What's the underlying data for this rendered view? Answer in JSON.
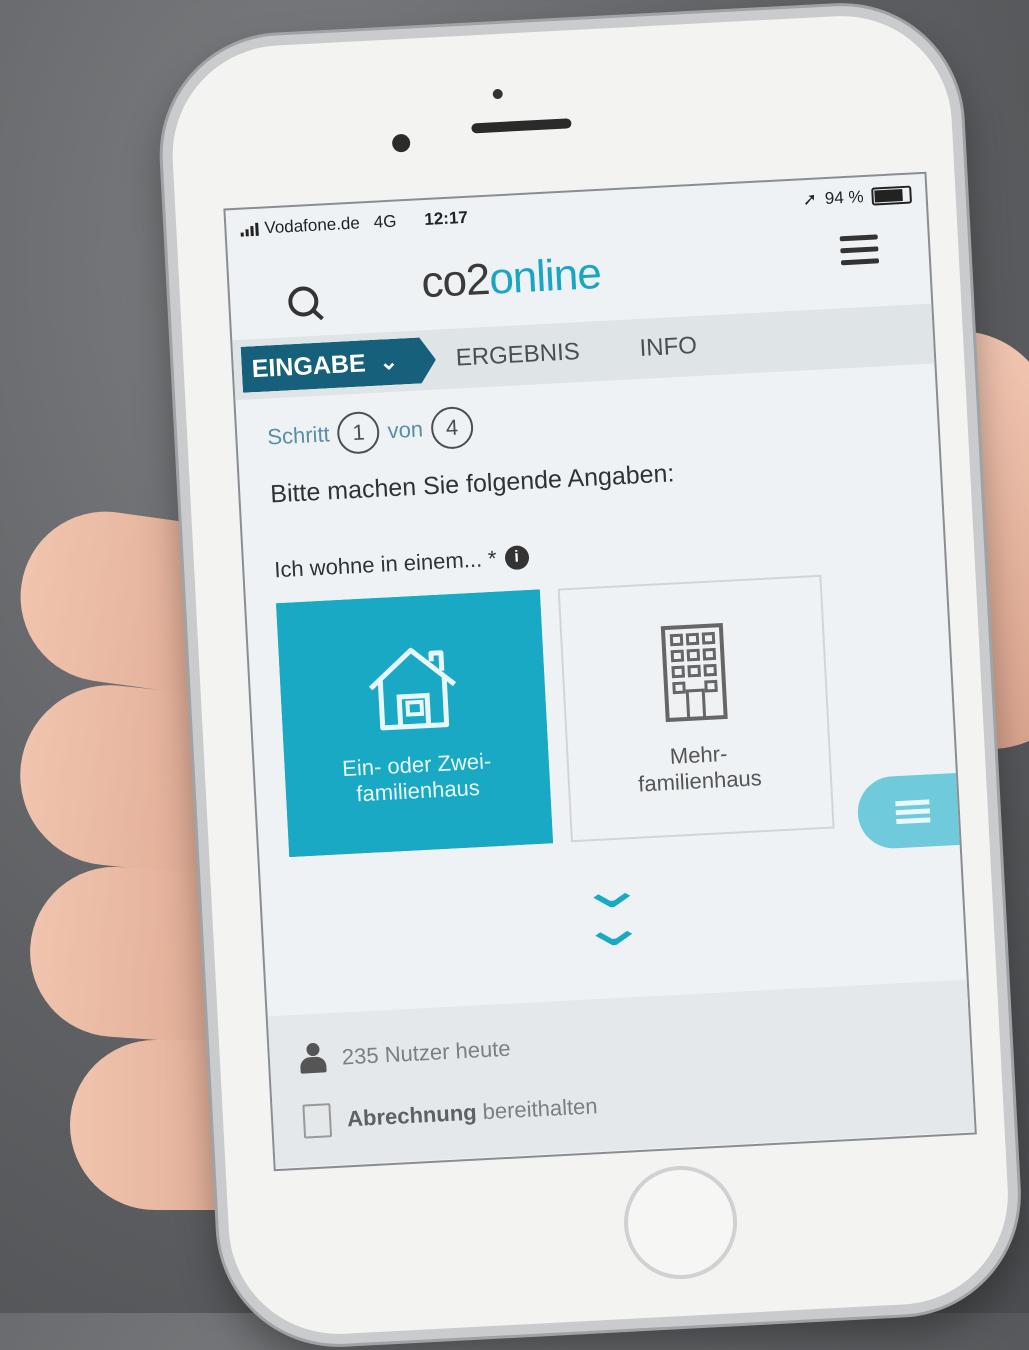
{
  "status_bar": {
    "carrier": "Vodafone.de",
    "network": "4G",
    "time": "12:17",
    "battery": "94 %"
  },
  "header": {
    "logo_prefix": "co2",
    "logo_suffix": "online"
  },
  "tabs": {
    "active": "EINGABE",
    "items": [
      "ERGEBNIS",
      "INFO"
    ]
  },
  "progress": {
    "label": "Schritt",
    "current": "1",
    "of_label": "von",
    "total": "4"
  },
  "prompt": "Bitte machen Sie folgende Angaben:",
  "question": "Ich wohne in einem... *",
  "options": [
    {
      "label_line1": "Ein- oder Zwei-",
      "label_line2": "familienhaus",
      "selected": true
    },
    {
      "label_line1": "Mehr-",
      "label_line2": "familienhaus",
      "selected": false
    }
  ],
  "footer": {
    "users_today": "235 Nutzer heute",
    "bill_bold": "Abrechnung",
    "bill_rest": "bereithalten"
  },
  "colors": {
    "accent": "#19a9c4",
    "tab_active": "#16607c"
  }
}
